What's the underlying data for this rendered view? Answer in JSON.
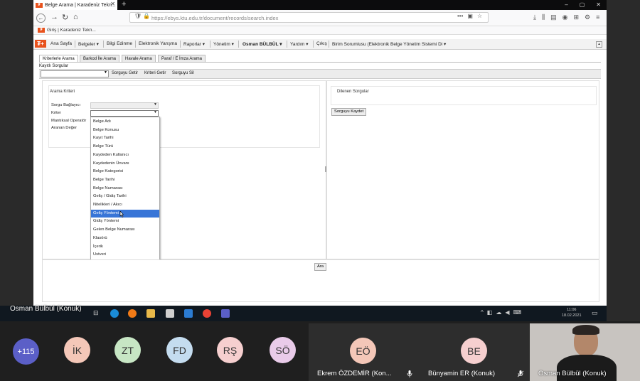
{
  "browser": {
    "tab_title": "Belge Arama | Karadeniz Tekn...",
    "url": "https://ebys.ktu.edu.tr/document/records/search.index",
    "bookmark": "Giriş | Karadeniz Tekn..."
  },
  "app_menu": {
    "items": [
      "Ana Sayfa",
      "Belgeler ▾",
      "Bilgi Edinme",
      "Elektronik Yarışma",
      "Raporlar ▾",
      "Yönetim ▾",
      "Osman BÜLBÜL ▾",
      "Yardım ▾",
      "Çıkış"
    ],
    "role": "Birim Sorumlusu (Elektronik Belge Yönetim Sistemi Di ▾"
  },
  "tabs": [
    "Kriterlerle Arama",
    "Barkod İle Arama",
    "Havale Arama",
    "Paraf / E İmza Arama"
  ],
  "saved_queries_label": "Kayıtlı Sorgular",
  "toolbar": {
    "get": "Sorguyu Getir",
    "clear": "Kriteri Getir",
    "delete": "Sorguyu Sil"
  },
  "search": {
    "title": "Arama Kriteri",
    "labels": [
      "Sorgu Bağlayıcı",
      "Kriter",
      "Mantıksal Operatör",
      "Aranan Değer"
    ],
    "criteria_options": [
      "Belge Adı",
      "Belge Konusu",
      "Kayıt Tarihi",
      "Belge Türü",
      "Kaydeden Kullanıcı",
      "Kaydedenin Ünvanı",
      "Belge Kategorisi",
      "Belge Tarihi",
      "Belge Numarası",
      "Geliş / Gidiş Tarihi",
      "Nitelikleri / Akıcı",
      "Geliş Yöntemi",
      "Gidiş Yöntemi",
      "Gelen Belge Numarası",
      "Klasörü",
      "İçerik",
      "Ustveri"
    ],
    "highlighted": "Geliş Yöntemi"
  },
  "saved_panel": {
    "title": "Dilenen Sorgular",
    "save_button": "Sorguyu Kaydet"
  },
  "search_button": "Ara",
  "presenter_label": "Osman Bülbül (Konuk)",
  "clock": {
    "time": "11:06",
    "date": "18.02.2021"
  },
  "participants": {
    "more_count": "+115",
    "avatars": [
      {
        "initials": "İK",
        "color": "#f4c7b8"
      },
      {
        "initials": "ZT",
        "color": "#c7e6c4"
      },
      {
        "initials": "FD",
        "color": "#c4dcef"
      },
      {
        "initials": "RŞ",
        "color": "#f6cfcf"
      },
      {
        "initials": "SÖ",
        "color": "#e9cbe9"
      }
    ],
    "tiles": [
      {
        "initials": "EÖ",
        "name": "Ekrem ÖZDEMİR (Kon...",
        "color": "#f4c7b8"
      },
      {
        "initials": "BE",
        "name": "Bünyamin ER (Konuk)",
        "color": "#f6cfcf"
      }
    ],
    "video_name": "Osman Bülbül (Konuk)"
  }
}
